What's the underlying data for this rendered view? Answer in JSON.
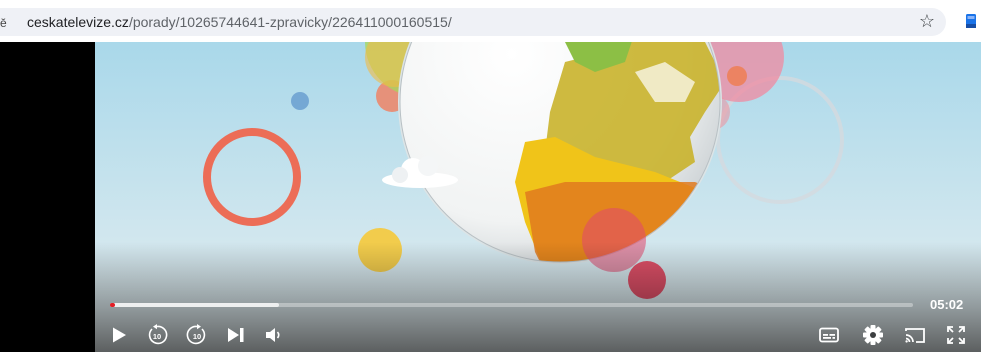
{
  "browser": {
    "site_info_glyph": "ĕ",
    "url_host": "ceskatelevize.cz",
    "url_path": "/porady/10265744641-zpravicky/226411000160515/",
    "bookmark_glyph": "☆",
    "icons": {
      "bookmark": "star-icon",
      "extension": "bookmark-extension-icon"
    }
  },
  "player": {
    "duration": "05:02",
    "progress": {
      "played_fraction": 0.006,
      "buffered_fraction": 0.21
    },
    "colors": {
      "accent": "#e21e26",
      "controls": "#ffffff"
    },
    "controls": {
      "left": [
        "play-icon",
        "rewind-10-icon",
        "forward-10-icon",
        "skip-next-icon",
        "volume-icon"
      ],
      "right": [
        "subtitles-icon",
        "settings-icon",
        "cast-icon",
        "fullscreen-icon"
      ],
      "rewind_seconds": "10",
      "forward_seconds": "10"
    }
  }
}
